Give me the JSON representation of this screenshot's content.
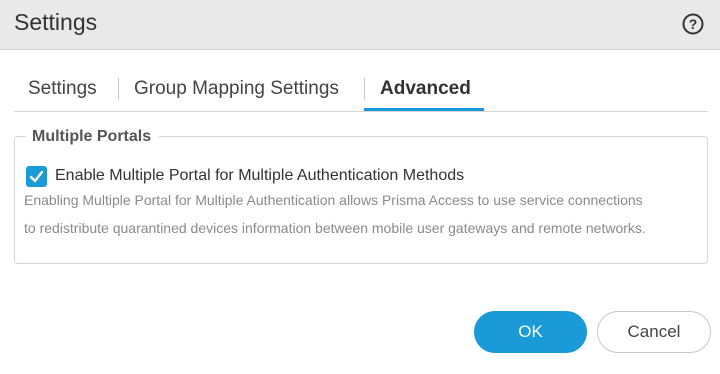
{
  "dialog": {
    "title": "Settings",
    "help_icon": "question-circle-icon"
  },
  "tabs": [
    {
      "label": "Settings",
      "active": false
    },
    {
      "label": "Group Mapping Settings",
      "active": false
    },
    {
      "label": "Advanced",
      "active": true
    }
  ],
  "section": {
    "legend": "Multiple Portals",
    "checkbox": {
      "label": "Enable Multiple Portal for Multiple Authentication Methods",
      "checked": true
    },
    "description_lines": [
      "Enabling Multiple Portal for Multiple Authentication allows Prisma Access to use service connections",
      "to redistribute quarantined devices information between mobile user gateways and remote networks."
    ]
  },
  "buttons": {
    "ok": "OK",
    "cancel": "Cancel"
  },
  "colors": {
    "accent": "#1a9ad6",
    "titlebar_bg": "#e9e9e9"
  }
}
